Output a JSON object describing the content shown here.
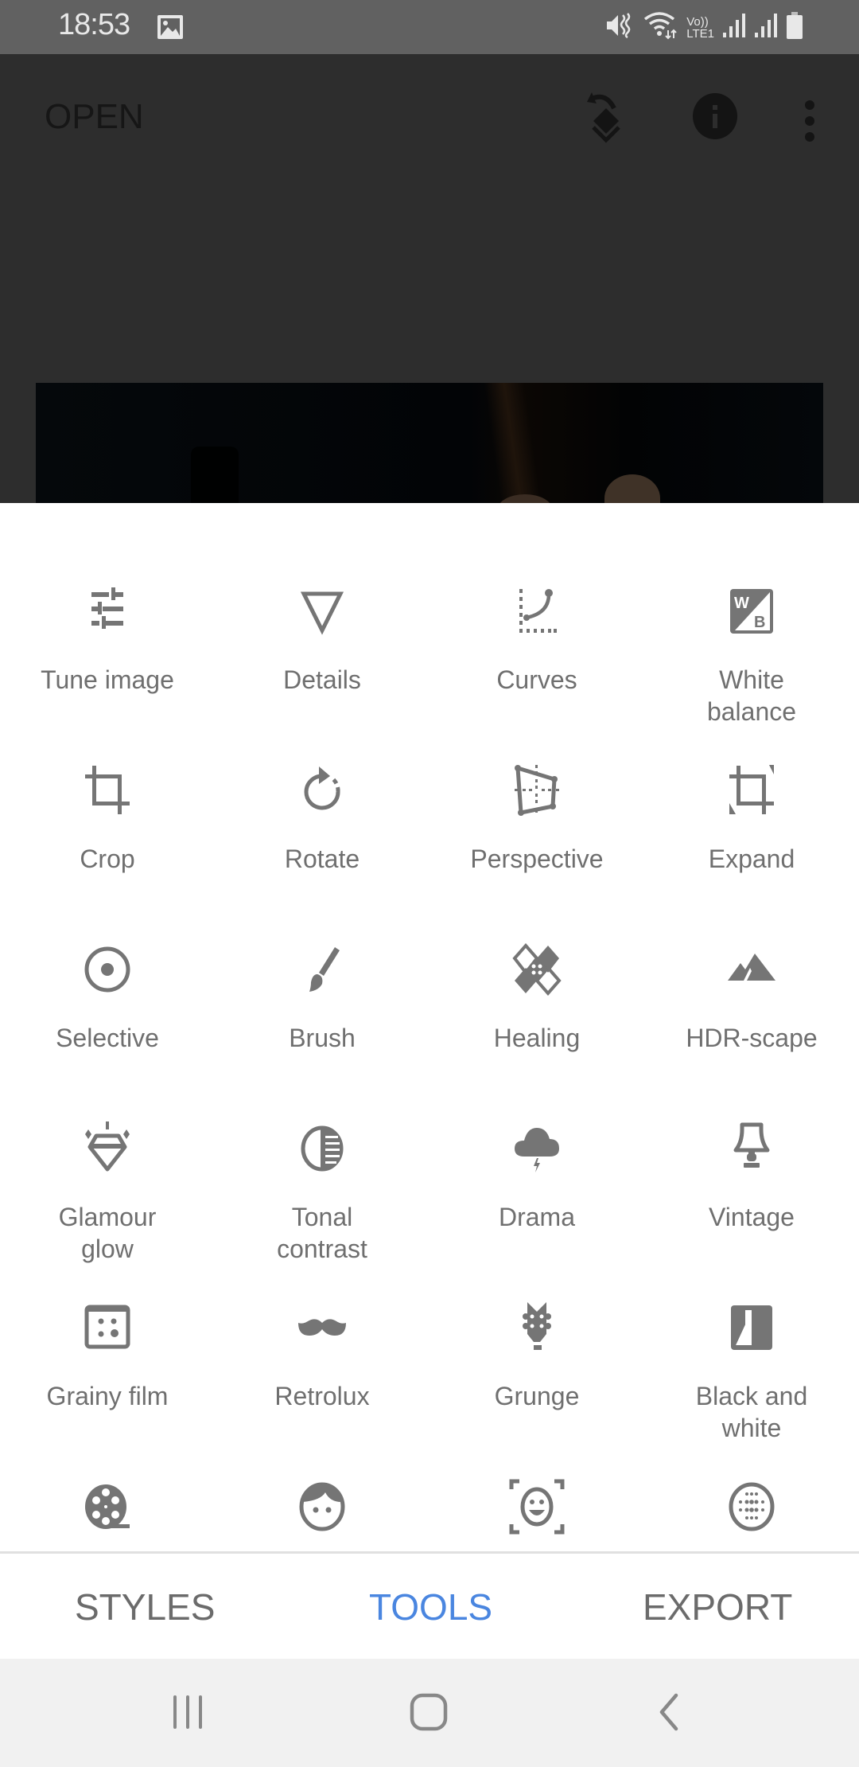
{
  "status_bar": {
    "time": "18:53",
    "left_icons": [
      "image-icon"
    ],
    "right_icons": [
      "mute-vibrate-icon",
      "wifi-icon",
      "volte-lte-icon",
      "signal-icon",
      "signal-icon",
      "battery-icon"
    ],
    "volte_label_top": "Vo))",
    "volte_label_bottom": "LTE1"
  },
  "app_bar": {
    "open_label": "OPEN",
    "actions": [
      "undo-layers-icon",
      "info-icon",
      "more-vert-icon"
    ]
  },
  "tools": [
    {
      "label": "Tune image",
      "icon": "tune-icon"
    },
    {
      "label": "Details",
      "icon": "details-triangle-icon"
    },
    {
      "label": "Curves",
      "icon": "curves-icon"
    },
    {
      "label": "White\nbalance",
      "icon": "white-balance-icon"
    },
    {
      "label": "Crop",
      "icon": "crop-icon"
    },
    {
      "label": "Rotate",
      "icon": "rotate-icon"
    },
    {
      "label": "Perspective",
      "icon": "perspective-icon"
    },
    {
      "label": "Expand",
      "icon": "expand-icon"
    },
    {
      "label": "Selective",
      "icon": "selective-icon"
    },
    {
      "label": "Brush",
      "icon": "brush-icon"
    },
    {
      "label": "Healing",
      "icon": "healing-bandage-icon"
    },
    {
      "label": "HDR-scape",
      "icon": "mountain-icon"
    },
    {
      "label": "Glamour\nglow",
      "icon": "diamond-icon"
    },
    {
      "label": "Tonal\ncontrast",
      "icon": "tonal-contrast-icon"
    },
    {
      "label": "Drama",
      "icon": "storm-cloud-icon"
    },
    {
      "label": "Vintage",
      "icon": "lamp-icon"
    },
    {
      "label": "Grainy film",
      "icon": "grain-icon"
    },
    {
      "label": "Retrolux",
      "icon": "mustache-icon"
    },
    {
      "label": "Grunge",
      "icon": "guitar-head-icon"
    },
    {
      "label": "Black and\nwhite",
      "icon": "black-white-icon"
    },
    {
      "label": "",
      "icon": "film-reel-icon"
    },
    {
      "label": "",
      "icon": "face-icon"
    },
    {
      "label": "",
      "icon": "face-detect-icon"
    },
    {
      "label": "",
      "icon": "dotted-circle-icon"
    }
  ],
  "bottom_tabs": [
    {
      "label": "STYLES",
      "active": false
    },
    {
      "label": "TOOLS",
      "active": true
    },
    {
      "label": "EXPORT",
      "active": false
    }
  ],
  "nav_bar": {
    "buttons": [
      "recent-apps-icon",
      "home-icon",
      "back-icon"
    ]
  },
  "colors": {
    "accent": "#4a86e0",
    "icon_gray": "#757575",
    "label_gray": "#6f6f6f",
    "status_bar_bg": "#616161",
    "app_bar_bg": "#2d2d2d"
  }
}
